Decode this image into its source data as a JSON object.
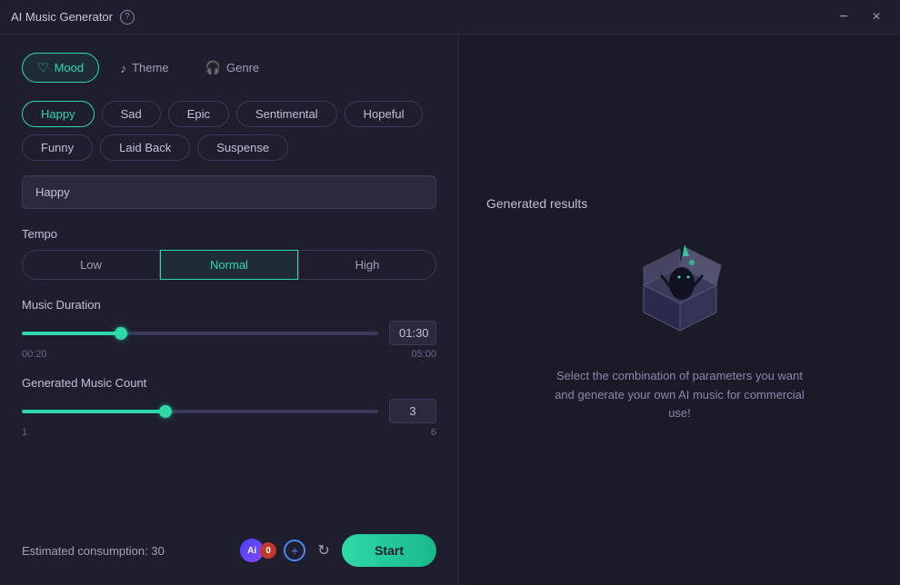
{
  "titleBar": {
    "title": "AI Music Generator",
    "helpIcon": "?",
    "minimizeLabel": "−",
    "closeLabel": "×"
  },
  "tabs": [
    {
      "id": "mood",
      "label": "Mood",
      "icon": "♡",
      "active": true
    },
    {
      "id": "theme",
      "label": "Theme",
      "icon": "🎵",
      "active": false
    },
    {
      "id": "genre",
      "label": "Genre",
      "icon": "🎧",
      "active": false
    }
  ],
  "moodButtons": [
    {
      "label": "Happy",
      "selected": true
    },
    {
      "label": "Sad",
      "selected": false
    },
    {
      "label": "Epic",
      "selected": false
    },
    {
      "label": "Sentimental",
      "selected": false
    },
    {
      "label": "Hopeful",
      "selected": false
    },
    {
      "label": "Funny",
      "selected": false
    },
    {
      "label": "Laid Back",
      "selected": false
    },
    {
      "label": "Suspense",
      "selected": false
    }
  ],
  "moodInputValue": "Happy",
  "tempo": {
    "label": "Tempo",
    "options": [
      {
        "label": "Low",
        "active": false
      },
      {
        "label": "Normal",
        "active": true
      },
      {
        "label": "High",
        "active": false
      }
    ]
  },
  "musicDuration": {
    "label": "Music Duration",
    "min": "00:20",
    "max": "05:00",
    "value": "01:30",
    "percent": 27
  },
  "musicCount": {
    "label": "Generated Music Count",
    "min": "1",
    "max": "6",
    "value": "3",
    "percent": 40
  },
  "bottomBar": {
    "consumptionLabel": "Estimated consumption: 30",
    "aiBadgeLabel": "Ai",
    "creditCount": "0",
    "startLabel": "Start"
  },
  "rightPanel": {
    "title": "Generated results",
    "description": "Select the combination of parameters you want and generate your own AI music for commercial use!"
  }
}
